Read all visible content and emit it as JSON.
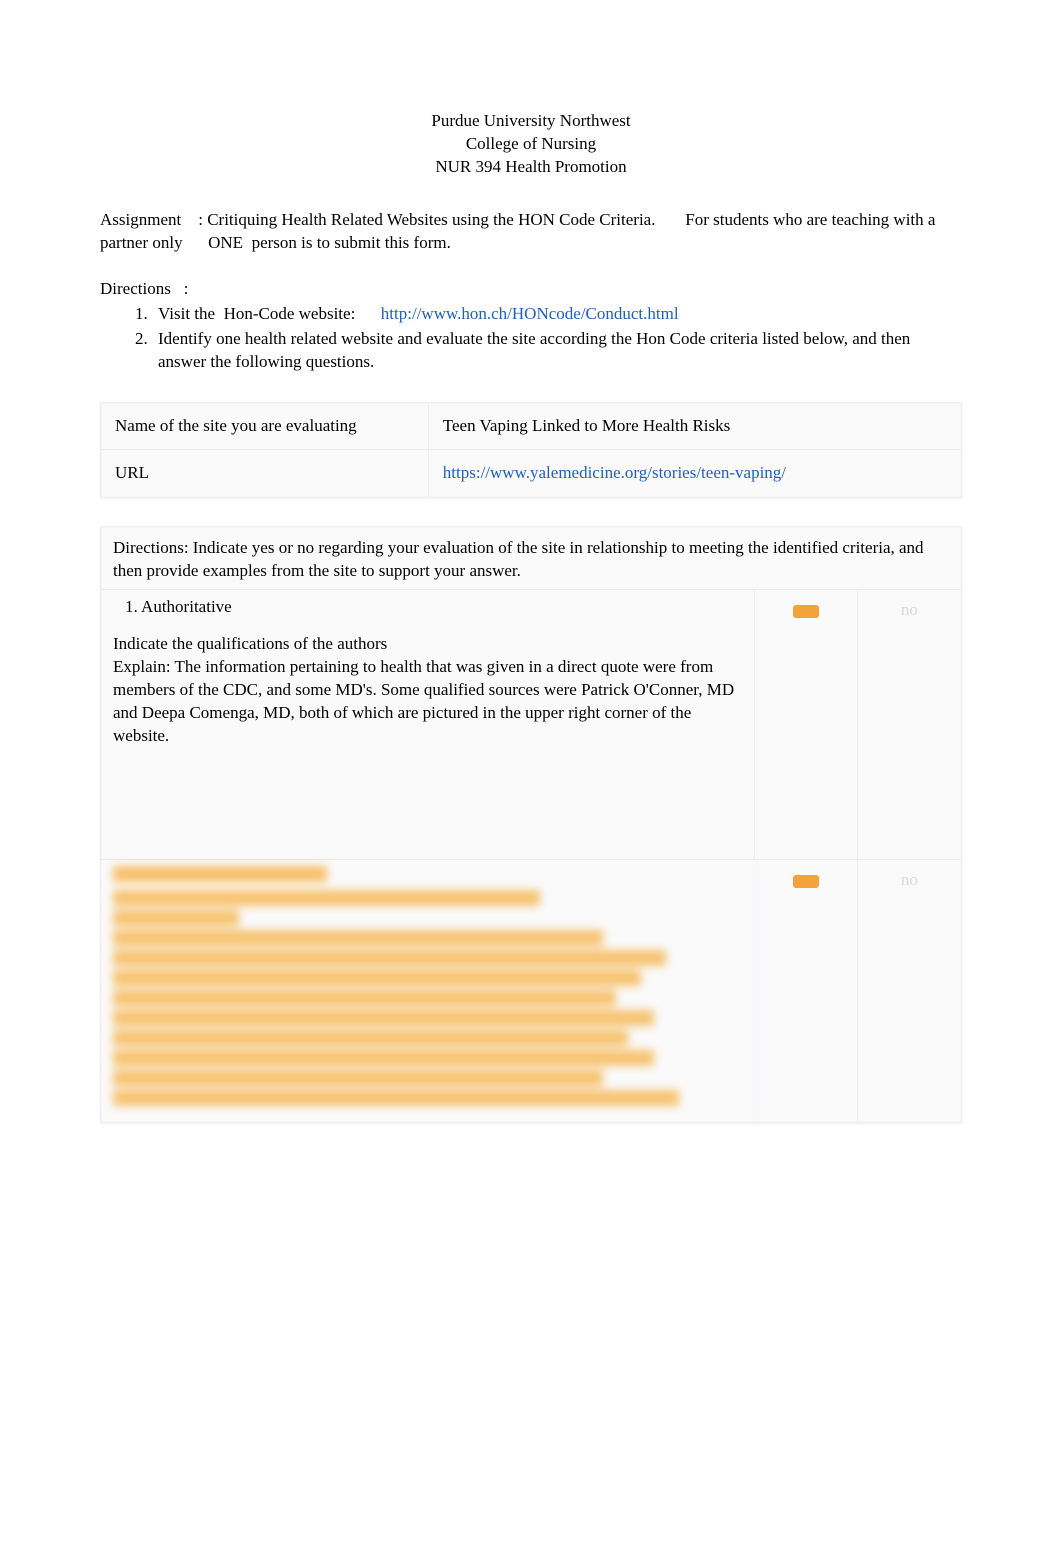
{
  "header": {
    "line1": "Purdue University Northwest",
    "line2": "College of Nursing",
    "line3": "NUR 394 Health Promotion"
  },
  "assignment": {
    "label": "Assignment",
    "text": ": Critiquing Health Related Websites using the HON Code Criteria.",
    "tail": "For students who are teaching with a partner only",
    "tail2": "ONE",
    "tail3": "person is to submit this form."
  },
  "directions": {
    "label": "Directions",
    "colon": ":",
    "item1_pre": "Visit the",
    "item1_mid": "Hon-Code website:",
    "item1_link": "http://www.hon.ch/HONcode/Conduct.html",
    "item2": "Identify one health related website and evaluate the site according the Hon Code criteria listed below, and then answer the following questions."
  },
  "table1": {
    "row1_label": "Name of the site you are evaluating",
    "row1_value": "Teen Vaping Linked to More Health Risks",
    "row2_label": "URL",
    "row2_value": "https://www.yalemedicine.org/stories/teen-vaping/"
  },
  "table2": {
    "intro": "Directions: Indicate yes or no regarding your evaluation of the site in relationship to meeting the identified criteria, and then provide examples from the site to support your answer.",
    "q1_heading": "1.    Authoritative",
    "q1_line1": "Indicate the qualifications of the authors",
    "q1_line2": "Explain:   The information pertaining to health that was given in a direct quote were from members of the CDC, and some MD's. Some qualified sources were Patrick O'Conner, MD and Deepa Comenga, MD, both of which are pictured in the upper right corner of the website.",
    "q1_yes": "yes",
    "q1_no": "no",
    "q2_heading": "2.    Complementarity",
    "q2_body": "Information should support, not replace, the doctor-patient relationship. Explain: Content from this website states which is in a super complementary, supportive health website manner, ... and adding to a healthy practitioner. Yes, while the articles on vaping indicate the best a young student might to address this, issue with kids patients, getting clean their use if they allowed, and telling them to the risk: NOT! and opened their fx if it was. The ultimate position the doctor and the lung, need to step up if the full effect, making a shocking children and parents on the danger of vaping. The site",
    "q2_yes": "yes",
    "q2_no": "no"
  }
}
